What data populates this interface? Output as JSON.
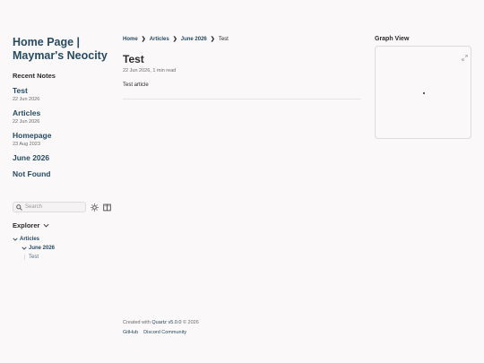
{
  "sidebar": {
    "site_title": "Home Page | Maymar's Neocity",
    "recent_heading": "Recent Notes",
    "notes": [
      {
        "title": "Test",
        "date": "22 Jun 2026"
      },
      {
        "title": "Articles",
        "date": "22 Jun 2026"
      },
      {
        "title": "Homepage",
        "date": "23 Aug 2023"
      },
      {
        "title": "June 2026",
        "date": ""
      },
      {
        "title": "Not Found",
        "date": ""
      }
    ],
    "search_placeholder": "Search",
    "explorer_label": "Explorer",
    "tree": {
      "folder": "Articles",
      "subfolder": "June 2026",
      "file": "Test"
    }
  },
  "main": {
    "breadcrumbs": [
      "Home",
      "Articles",
      "June 2026",
      "Test"
    ],
    "title": "Test",
    "meta": "22 Jun 2026,  1 min read",
    "body": "Test article"
  },
  "graph": {
    "title": "Graph View"
  },
  "footer": {
    "created_prefix": "Created with ",
    "quartz": "Quartz v5.0.0",
    "created_suffix": " © 2026",
    "links": [
      "GitHub",
      "Discord Community"
    ]
  },
  "icons": {
    "search": "search-icon",
    "theme": "sun-icon",
    "reader": "book-icon",
    "expand": "expand-icon",
    "chevron": "chevron-down-icon"
  },
  "colors": {
    "accent": "#284b63",
    "background": "#faf8f8",
    "text": "#2b2b2b"
  }
}
